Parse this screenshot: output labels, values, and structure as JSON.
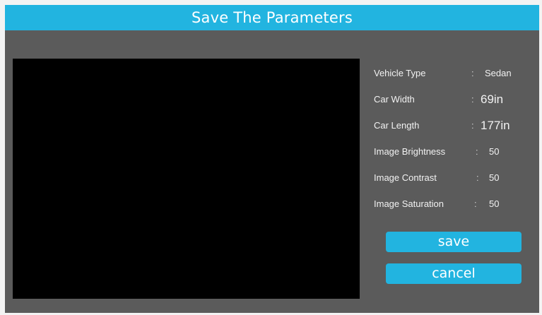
{
  "dialog": {
    "title": "Save The Parameters"
  },
  "params": [
    {
      "label": "Vehicle Type",
      "value": "Sedan"
    },
    {
      "label": "Car Width",
      "value": "69in"
    },
    {
      "label": "Car Length",
      "value": "177in"
    },
    {
      "label": "Image Brightness",
      "value": "50"
    },
    {
      "label": "Image Contrast",
      "value": "50"
    },
    {
      "label": "Image Saturation",
      "value": "50"
    }
  ],
  "separator": ":",
  "buttons": {
    "save_label": "save",
    "cancel_label": "cancel"
  },
  "colors": {
    "accent": "#22b4e0",
    "panel": "#5b5b5b",
    "preview": "#000000"
  }
}
